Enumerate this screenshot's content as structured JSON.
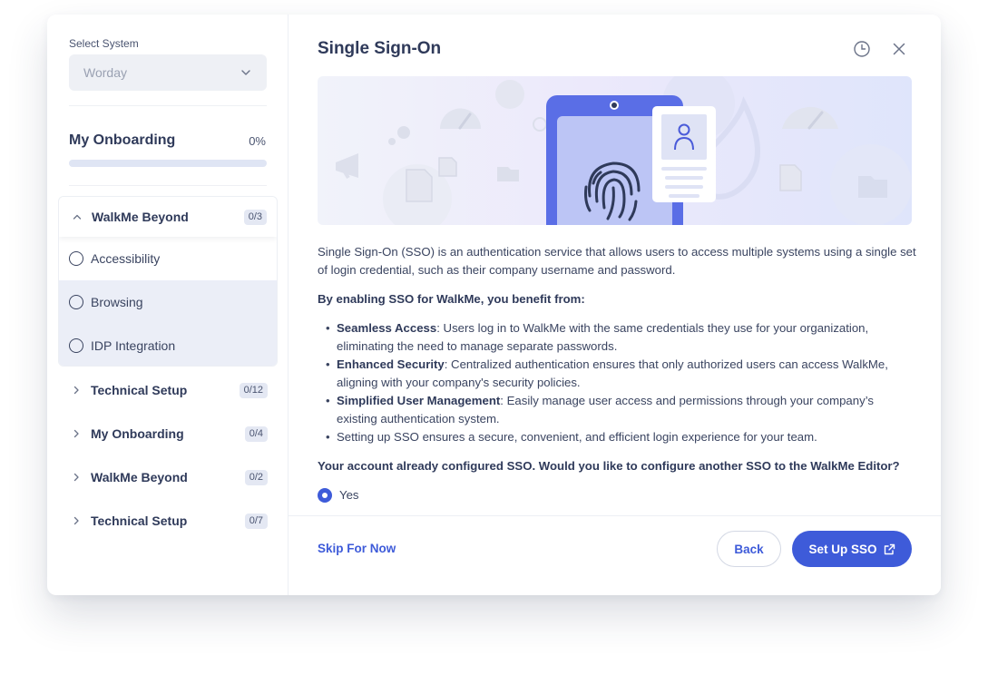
{
  "sidebar": {
    "select_label": "Select System",
    "select_value": "Worday",
    "onboarding_title": "My Onboarding",
    "onboarding_percent": "0%",
    "progress_fraction": 0,
    "open_group": {
      "title": "WalkMe Beyond",
      "count": "0/3",
      "tasks": [
        "Accessibility",
        "Browsing",
        "IDP Integration"
      ]
    },
    "groups": [
      {
        "title": "Technical Setup",
        "count": "0/12"
      },
      {
        "title": "My Onboarding",
        "count": "0/4"
      },
      {
        "title": "WalkMe Beyond",
        "count": "0/2"
      },
      {
        "title": "Technical Setup",
        "count": "0/7"
      }
    ]
  },
  "main": {
    "title": "Single Sign-On",
    "intro": "Single Sign-On (SSO) is an authentication service that allows users to access multiple systems using a single set of login credential, such as their company username and password.",
    "benefits_heading": "By enabling SSO for WalkMe, you benefit from:",
    "benefits": [
      {
        "term": "Seamless Access",
        "text": ": Users log in to WalkMe with the same credentials they use for your organization, eliminating the need to manage separate passwords."
      },
      {
        "term": "Enhanced Security",
        "text": ": Centralized authentication ensures that only authorized users can access WalkMe, aligning with your company's security policies."
      },
      {
        "term": "Simplified User Management",
        "text": ": Easily manage user access and permissions through your company’s existing authentication system."
      },
      {
        "term": "",
        "text": "Setting up SSO ensures a secure, convenient, and efficient login experience for your team."
      }
    ],
    "question": "Your account already configured SSO. Would you like to configure another SSO to the WalkMe Editor?",
    "yes_label": "Yes"
  },
  "footer": {
    "skip_label": "Skip For Now",
    "back_label": "Back",
    "setup_label": "Set Up SSO"
  },
  "icons": {
    "header": [
      "history-icon",
      "close-icon"
    ],
    "select": "chevron-down-icon",
    "setup": "external-link-icon"
  },
  "colors": {
    "accent": "#3e5bd9",
    "text": "#2f3a5a",
    "tint": "#ebeef7"
  }
}
